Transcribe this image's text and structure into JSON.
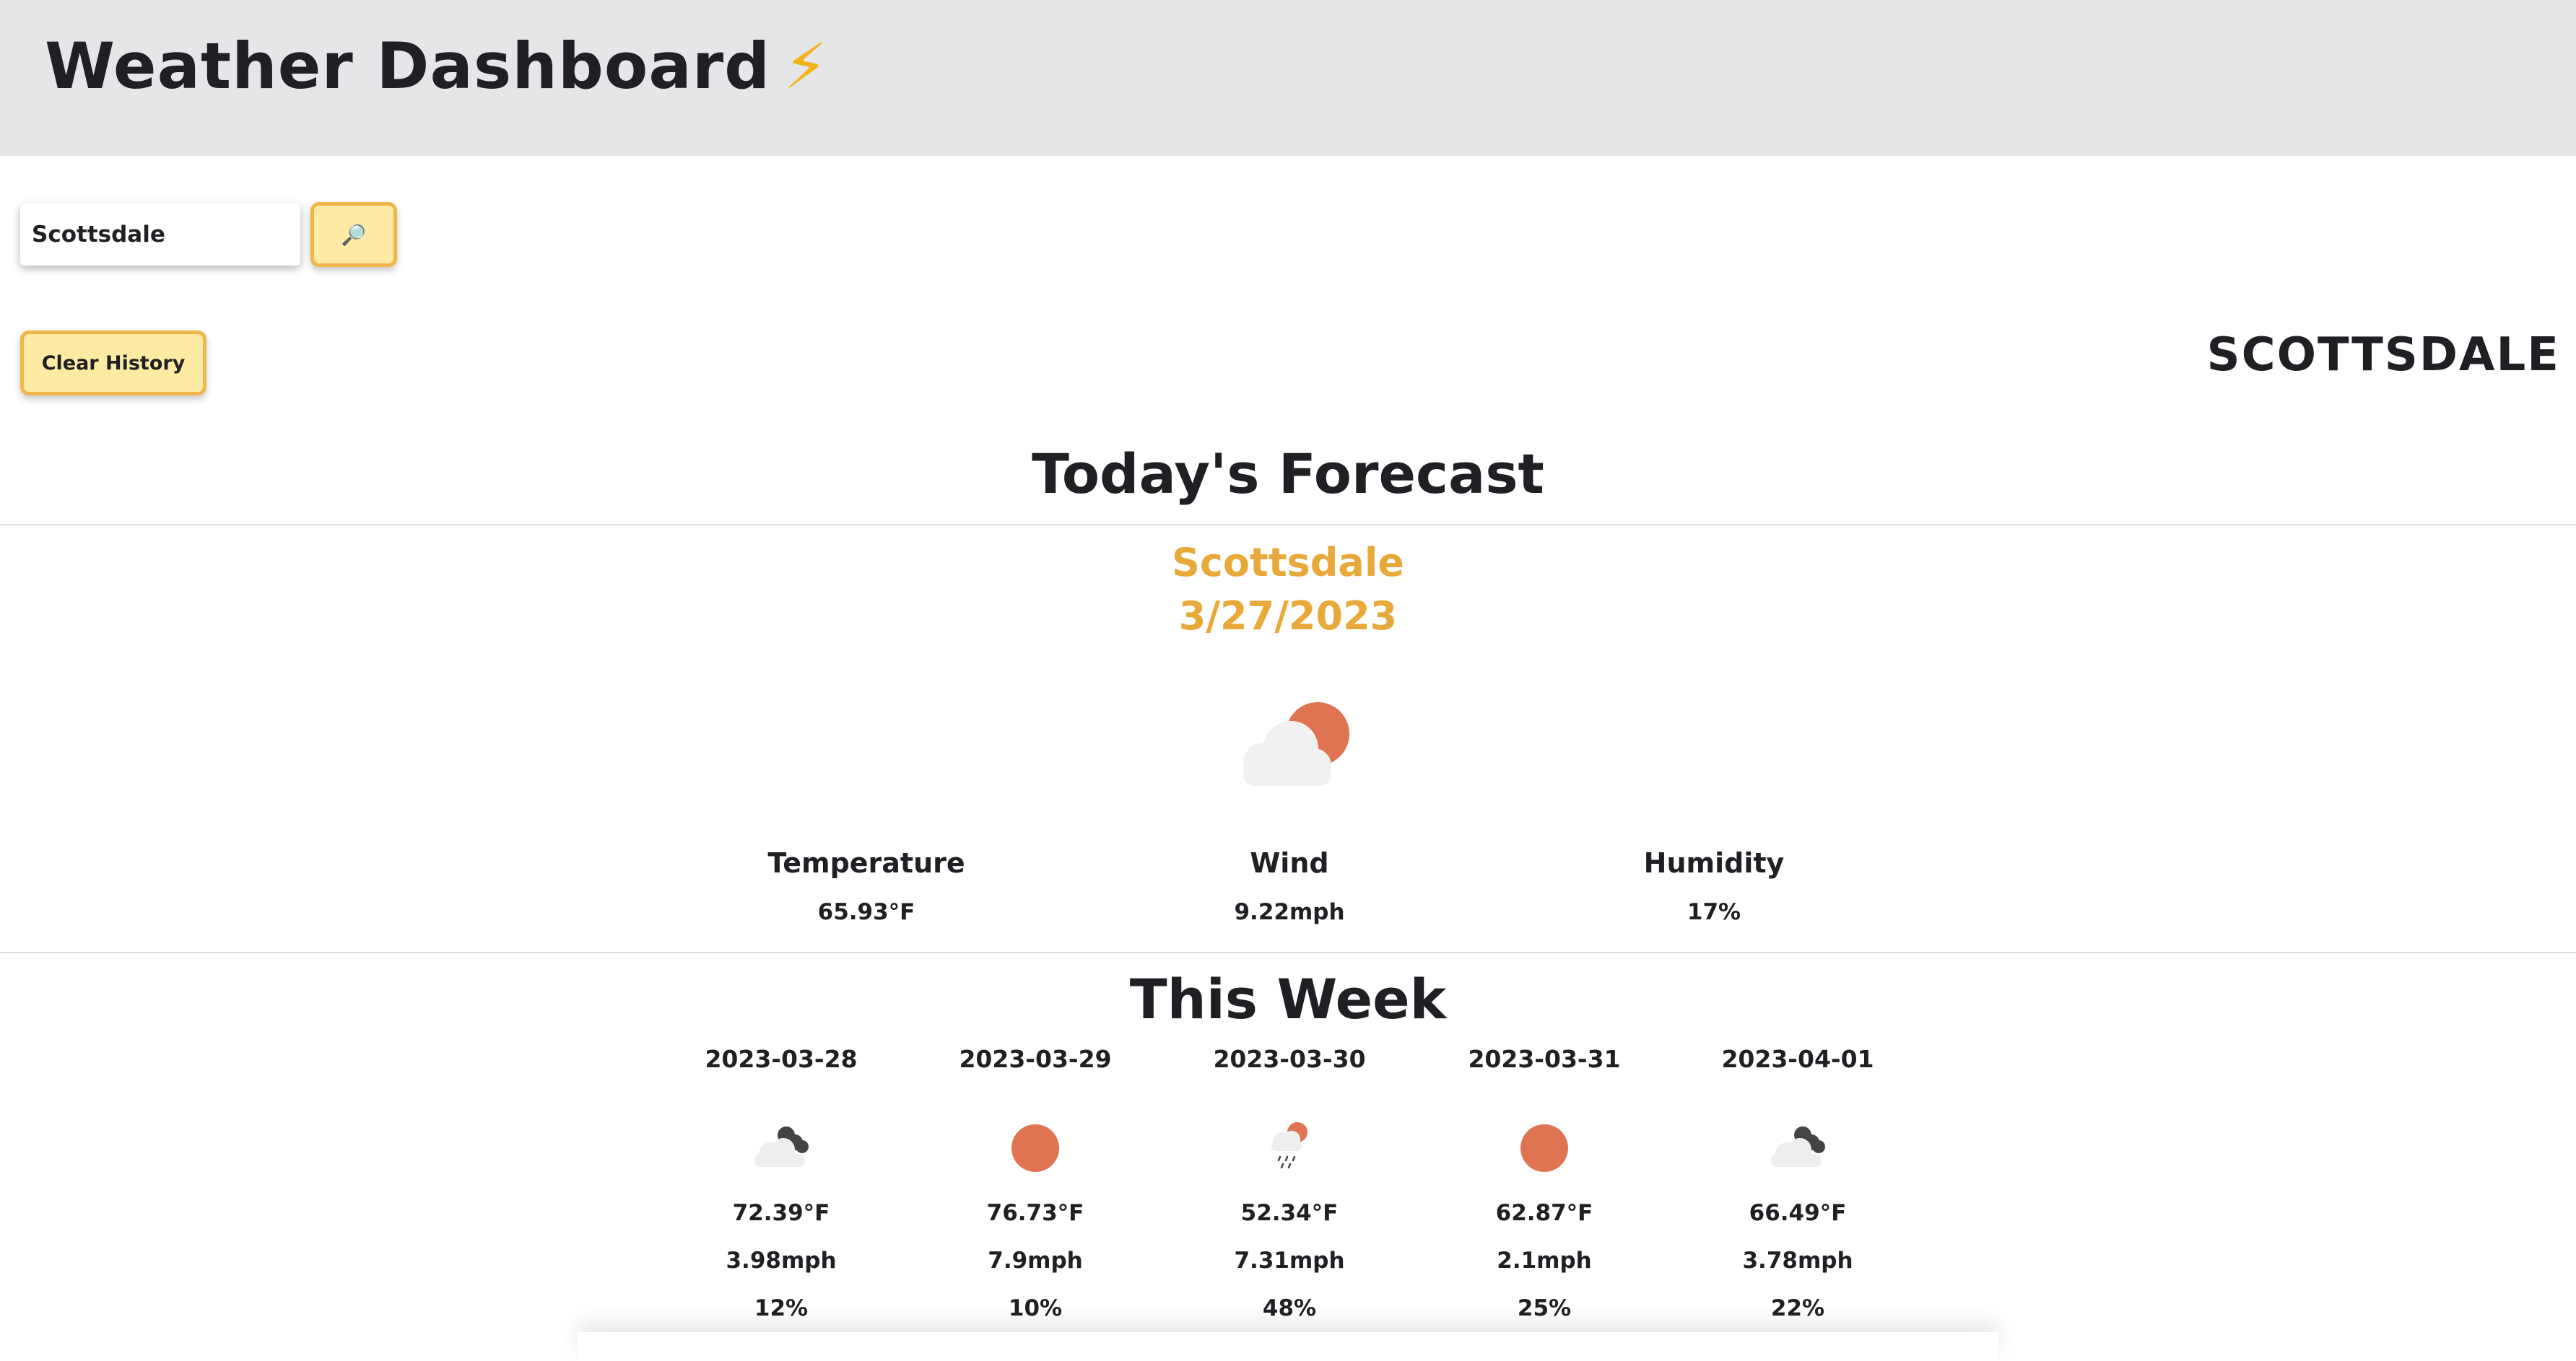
{
  "header": {
    "title": "Weather Dashboard",
    "emoji": "⚡"
  },
  "search": {
    "value": "Scottsdale",
    "button_icon": "🔎",
    "icon_name": "search-icon"
  },
  "history": {
    "clear_label": "Clear History",
    "cities": [
      "SCOTTSDALE"
    ]
  },
  "today": {
    "section_title": "Today's Forecast",
    "city": "Scottsdale",
    "date": "3/27/2023",
    "icon": "partly-cloudy-day-icon",
    "temperature_label": "Temperature",
    "temperature": "65.93°F",
    "wind_label": "Wind",
    "wind": "9.22mph",
    "humidity_label": "Humidity",
    "humidity": "17%"
  },
  "week": {
    "section_title": "This Week",
    "days": [
      {
        "date": "2023-03-28",
        "icon": "cloudy-icon",
        "temp": "72.39°F",
        "wind": "3.98mph",
        "humidity": "12%"
      },
      {
        "date": "2023-03-29",
        "icon": "sun-icon",
        "temp": "76.73°F",
        "wind": "7.9mph",
        "humidity": "10%"
      },
      {
        "date": "2023-03-30",
        "icon": "rain-sun-icon",
        "temp": "52.34°F",
        "wind": "7.31mph",
        "humidity": "48%"
      },
      {
        "date": "2023-03-31",
        "icon": "sun-icon",
        "temp": "62.87°F",
        "wind": "2.1mph",
        "humidity": "25%"
      },
      {
        "date": "2023-04-01",
        "icon": "cloudy-icon",
        "temp": "66.49°F",
        "wind": "3.78mph",
        "humidity": "22%"
      }
    ]
  },
  "colors": {
    "header_bg": "#e5e6e8",
    "accent": "#e9a93a",
    "button_bg": "#fdeaa3",
    "button_border": "#f0b64a",
    "sun": "#e07352"
  }
}
